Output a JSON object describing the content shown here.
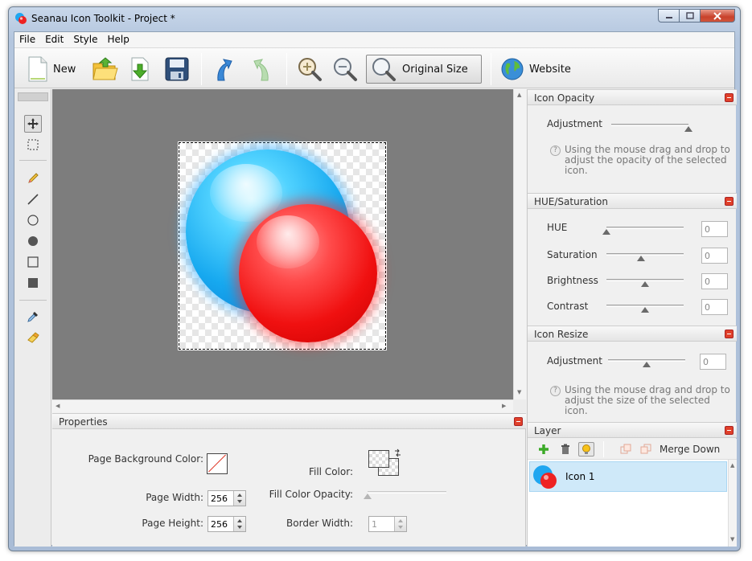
{
  "window": {
    "title": "Seanau Icon Toolkit - Project *",
    "controls": {
      "minimize": "–",
      "maximize": "□",
      "close": "✕"
    }
  },
  "menu": [
    "File",
    "Edit",
    "Style",
    "Help"
  ],
  "toolbar": {
    "new_label": "New",
    "original_size_label": "Original Size",
    "website_label": "Website",
    "icons": [
      "new-document-icon",
      "open-folder-icon",
      "import-icon",
      "save-icon",
      "undo-icon",
      "redo-icon",
      "zoom-in-icon",
      "zoom-out-icon",
      "magnifier-icon",
      "globe-icon"
    ]
  },
  "tools": [
    "move-tool-icon",
    "marquee-select-icon",
    "pencil-icon",
    "line-icon",
    "ellipse-outline-icon",
    "ellipse-filled-icon",
    "rectangle-outline-icon",
    "rectangle-filled-icon",
    "eyedropper-icon",
    "eraser-icon"
  ],
  "properties": {
    "title": "Properties",
    "page_background_color_label": "Page Background Color:",
    "page_width_label": "Page Width:",
    "page_width_value": "256",
    "page_height_label": "Page Height:",
    "page_height_value": "256",
    "fill_color_label": "Fill Color:",
    "fill_color_opacity_label": "Fill Color Opacity:",
    "fill_color_opacity_level": 0,
    "border_width_label": "Border Width:",
    "border_width_value": "1"
  },
  "icon_opacity": {
    "title": "Icon Opacity",
    "adjustment_label": "Adjustment",
    "adjustment_level": 1.0,
    "hint": "Using the mouse drag and drop to adjust the opacity of the selected icon."
  },
  "hue_saturation": {
    "title": "HUE/Saturation",
    "rows": [
      {
        "label": "HUE",
        "value": "0",
        "level": 0.0
      },
      {
        "label": "Saturation",
        "value": "0",
        "level": 0.45
      },
      {
        "label": "Brightness",
        "value": "0",
        "level": 0.5
      },
      {
        "label": "Contrast",
        "value": "0",
        "level": 0.5
      }
    ]
  },
  "icon_resize": {
    "title": "Icon Resize",
    "adjustment_label": "Adjustment",
    "adjustment_value": "0",
    "adjustment_level": 0.5,
    "hint": "Using the mouse drag and drop to adjust the size of the selected icon."
  },
  "layer": {
    "title": "Layer",
    "merge_down_label": "Merge Down",
    "items": [
      {
        "name": "Icon 1"
      }
    ]
  },
  "colors": {
    "canvas_background": "#7d7d7d",
    "close_button": "#e0402a",
    "layer_selected": "#cfe9f9",
    "blue_ball": "#16a8ef",
    "red_ball": "#f01010"
  }
}
